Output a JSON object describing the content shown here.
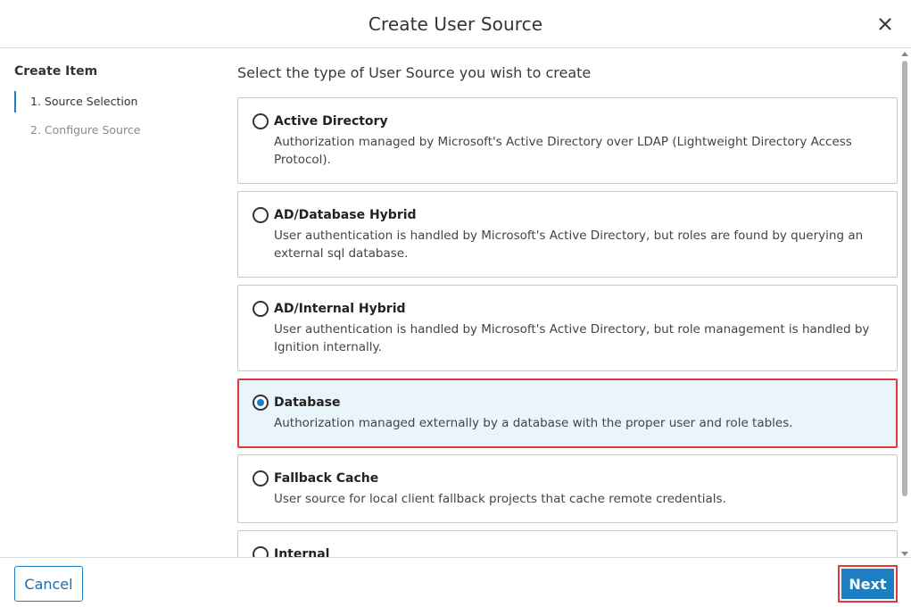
{
  "dialog": {
    "title": "Create User Source",
    "close_icon": "close-icon"
  },
  "steps": {
    "title": "Create Item",
    "items": [
      {
        "label": "1. Source Selection"
      },
      {
        "label": "2. Configure Source"
      }
    ]
  },
  "main": {
    "prompt": "Select the type of User Source you wish to create",
    "options": [
      {
        "title": "Active Directory",
        "description": "Authorization managed by Microsoft's Active Directory over LDAP (Lightweight Directory Access Protocol)."
      },
      {
        "title": "AD/Database Hybrid",
        "description": "User authentication is handled by Microsoft's Active Directory, but roles are found by querying an external sql database."
      },
      {
        "title": "AD/Internal Hybrid",
        "description": "User authentication is handled by Microsoft's Active Directory, but role management is handled by Ignition internally."
      },
      {
        "title": "Database",
        "description": "Authorization managed externally by a database with the proper user and role tables."
      },
      {
        "title": "Fallback Cache",
        "description": "User source for local client fallback projects that cache remote credentials."
      },
      {
        "title": "Internal",
        "description": ""
      }
    ],
    "selected": "Database"
  },
  "footer": {
    "cancel_label": "Cancel",
    "next_label": "Next"
  },
  "colors": {
    "accent": "#1d7fc2",
    "highlight_border": "#e0383e",
    "selected_bg": "#eaf4fb"
  }
}
